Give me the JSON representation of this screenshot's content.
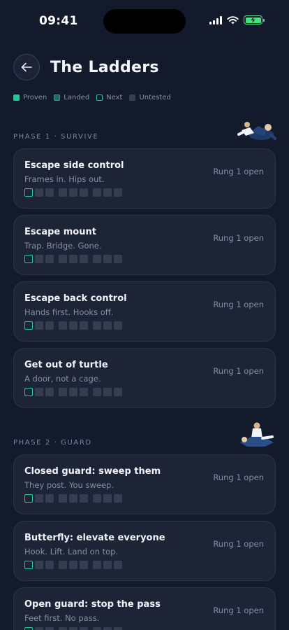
{
  "status_bar": {
    "time": "09:41"
  },
  "header": {
    "title": "The Ladders"
  },
  "legend": [
    {
      "label": "Proven",
      "key": "proven"
    },
    {
      "label": "Landed",
      "key": "landed"
    },
    {
      "label": "Next",
      "key": "next"
    },
    {
      "label": "Untested",
      "key": "untested"
    }
  ],
  "colors": {
    "background": "#131a2b",
    "card": "#1d2436",
    "accent": "#1fc99a",
    "untested": "#353d50"
  },
  "phases": [
    {
      "label": "PHASE 1 · SURVIVE",
      "items": [
        {
          "title": "Escape side control",
          "subtitle": "Frames in. Hips out.",
          "status": "Rung 1 open"
        },
        {
          "title": "Escape mount",
          "subtitle": "Trap. Bridge. Gone.",
          "status": "Rung 1 open"
        },
        {
          "title": "Escape back control",
          "subtitle": "Hands first. Hooks off.",
          "status": "Rung 1 open"
        },
        {
          "title": "Get out of turtle",
          "subtitle": "A door, not a cage.",
          "status": "Rung 1 open"
        }
      ]
    },
    {
      "label": "PHASE 2 · GUARD",
      "items": [
        {
          "title": "Closed guard: sweep them",
          "subtitle": "They post. You sweep.",
          "status": "Rung 1 open"
        },
        {
          "title": "Butterfly: elevate everyone",
          "subtitle": "Hook. Lift. Land on top.",
          "status": "Rung 1 open"
        },
        {
          "title": "Open guard: stop the pass",
          "subtitle": "Feet first. No pass.",
          "status": "Rung 1 open"
        }
      ]
    }
  ],
  "rung_states": [
    "next",
    "untested",
    "untested",
    "untested",
    "untested",
    "untested",
    "untested",
    "untested",
    "untested"
  ]
}
